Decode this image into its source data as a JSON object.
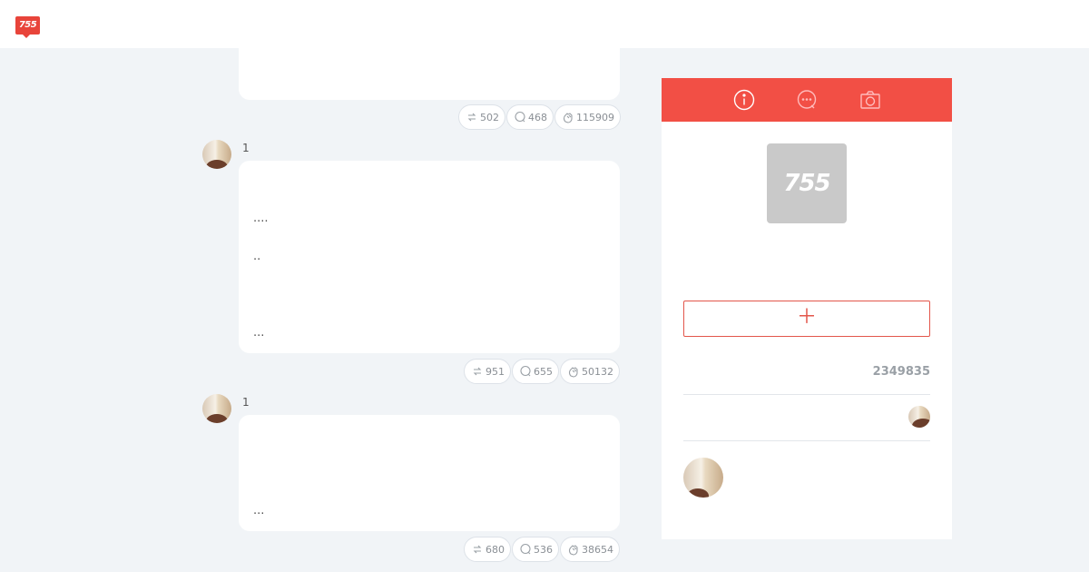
{
  "header": {
    "logo_text": "755"
  },
  "posts": [
    {
      "lines": [],
      "stats": {
        "repost": "502",
        "comment": "468",
        "applause": "115909"
      }
    },
    {
      "username": "1",
      "lines": [
        "....",
        "..",
        "..."
      ],
      "stats": {
        "repost": "951",
        "comment": "655",
        "applause": "50132"
      }
    },
    {
      "username": "1",
      "lines": [
        "..."
      ],
      "stats": {
        "repost": "680",
        "comment": "536",
        "applause": "38654"
      }
    }
  ],
  "sidebar": {
    "tabs": [
      {
        "icon": "info-icon"
      },
      {
        "icon": "chat-bubble-icon"
      },
      {
        "icon": "camera-icon"
      }
    ],
    "profile_logo_text": "755",
    "follow_symbol": "＋",
    "follower_count": "2349835"
  },
  "colors": {
    "accent": "#f24f45",
    "background": "#f1f4f7"
  }
}
